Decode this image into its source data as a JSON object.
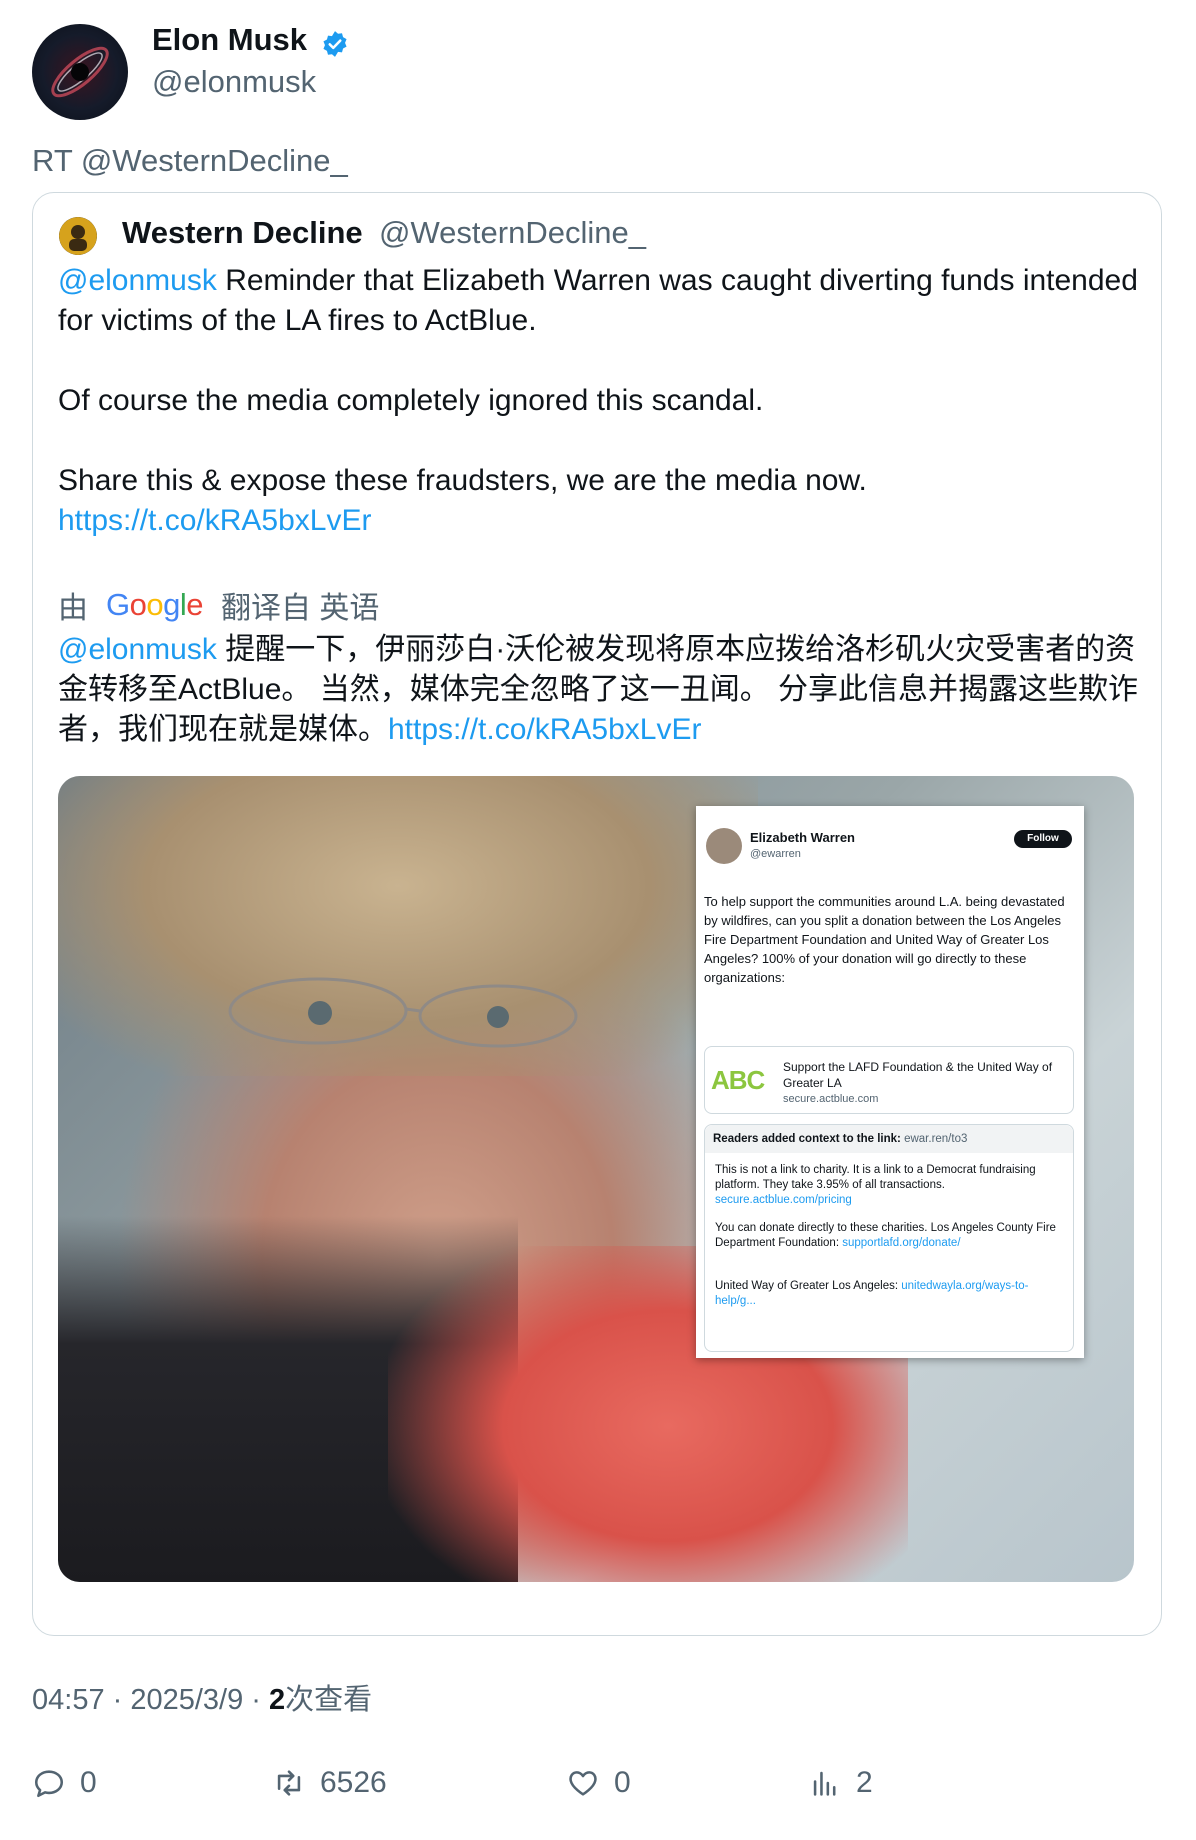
{
  "author": {
    "name": "Elon Musk",
    "handle": "@elonmusk",
    "verified_color": "#1d9bf0"
  },
  "retweet_label": "RT @WesternDecline_",
  "quoted": {
    "name": "Western Decline",
    "handle": "@WesternDecline_",
    "mention": "@elonmusk",
    "line1_rest": " Reminder that Elizabeth Warren was caught diverting funds intended for victims of the LA fires to ActBlue.",
    "line2": "Of course the media completely ignored this scandal.",
    "line3": "Share this & expose these fraudsters, we are the media now.",
    "link": "https://t.co/kRA5bxLvEr",
    "translation": {
      "prefix": "由",
      "provider": "Google",
      "suffix": "翻译自 英语",
      "mention": "@elonmusk",
      "text": " 提醒一下，伊丽莎白·沃伦被发现将原本应拨给洛杉矶火灾受害者的资金转移至ActBlue。 当然，媒体完全忽略了这一丑闻。 分享此信息并揭露这些欺诈者，我们现在就是媒体。",
      "link": "https://t.co/kRA5bxLvEr"
    },
    "image_screenshot": {
      "name": "Elizabeth Warren",
      "handle": "@ewarren",
      "follow_label": "Follow",
      "body": "To help support the communities around L.A. being devastated by wildfires, can you split a donation between the Los Angeles Fire Department Foundation and United Way of Greater Los Angeles? 100% of your donation will go directly to these organizations:",
      "card_logo": "ABC",
      "card_title": "Support the LAFD Foundation & the United Way of Greater LA",
      "card_domain": "secure.actblue.com",
      "notes_header": "Readers added context to the link:",
      "notes_header_link": "ewar.ren/to3",
      "note1": "This is not a link to charity. It is a link to a Democrat fundraising platform. They take 3.95% of all transactions.",
      "note1_link": "secure.actblue.com/pricing",
      "note2": "You can donate directly to these charities. Los Angeles County Fire Department Foundation:",
      "note2_link": "supportlafd.org/donate/",
      "note3": "United Way of Greater Los Angeles:",
      "note3_link": "unitedwayla.org/ways-to-help/g..."
    }
  },
  "meta": {
    "time": "04:57",
    "sep1": " · ",
    "date": "2025/3/9",
    "sep2": " · ",
    "views_count": "2",
    "views_label": "次查看"
  },
  "actions": {
    "replies": "0",
    "retweets": "6526",
    "likes": "0",
    "views": "2"
  }
}
